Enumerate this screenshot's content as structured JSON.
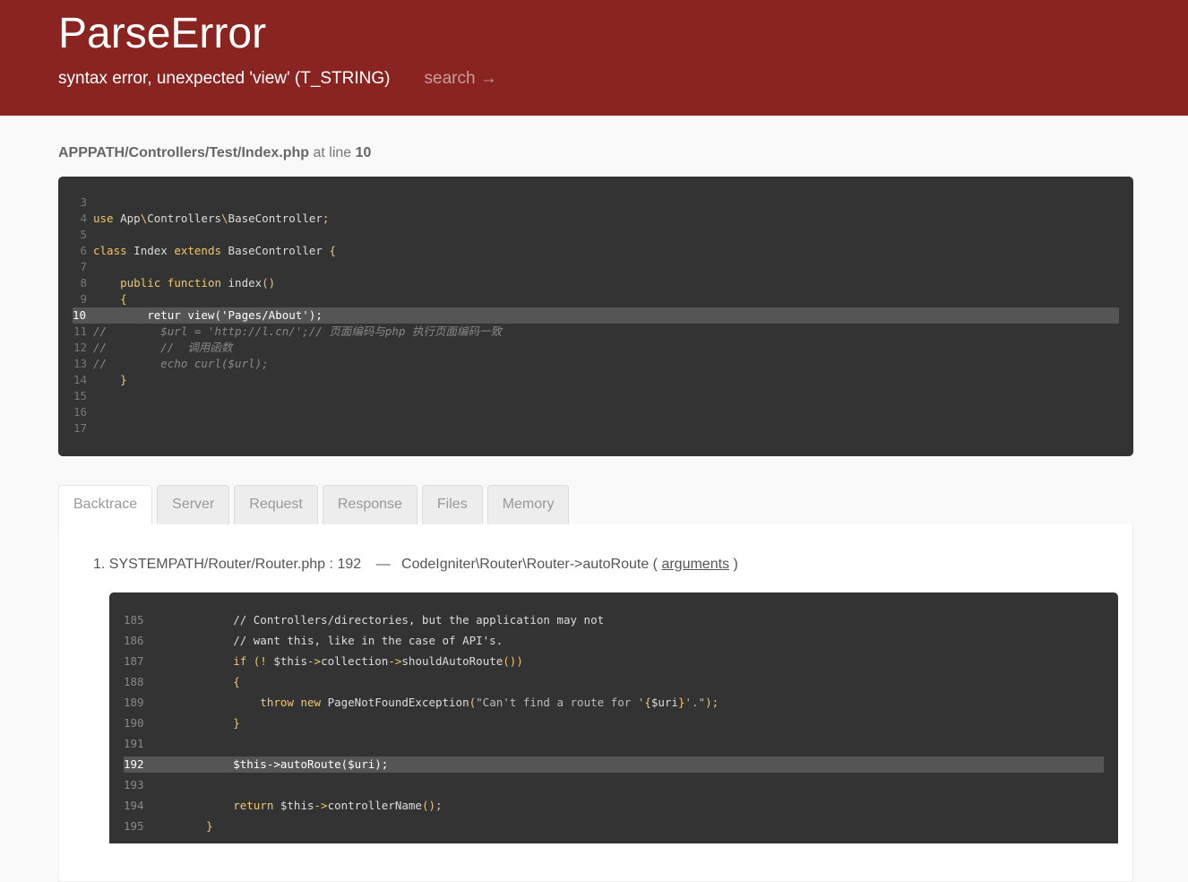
{
  "header": {
    "title": "ParseError",
    "message": "syntax error, unexpected 'view' (T_STRING)",
    "search_label": "search →"
  },
  "file": {
    "path": "APPPATH/Controllers/Test/Index.php",
    "at_line_label": "at line",
    "line": "10"
  },
  "source": {
    "highlight_line": "10",
    "lines": [
      {
        "n": "3",
        "parts": []
      },
      {
        "n": "4",
        "parts": [
          [
            "kw",
            "use"
          ],
          [
            "",
            " App"
          ],
          [
            "kw",
            "\\"
          ],
          [
            "",
            "Controllers"
          ],
          [
            "kw",
            "\\"
          ],
          [
            "",
            "BaseController"
          ],
          [
            "kw",
            ";"
          ]
        ]
      },
      {
        "n": "5",
        "parts": []
      },
      {
        "n": "6",
        "parts": [
          [
            "kw",
            "class"
          ],
          [
            "",
            " Index "
          ],
          [
            "kw",
            "extends"
          ],
          [
            "",
            " BaseController "
          ],
          [
            "kw",
            "{"
          ]
        ]
      },
      {
        "n": "7",
        "parts": []
      },
      {
        "n": "8",
        "parts": [
          [
            "",
            "    "
          ],
          [
            "kw",
            "public function"
          ],
          [
            "",
            " index"
          ],
          [
            "kw",
            "()"
          ]
        ]
      },
      {
        "n": "9",
        "parts": [
          [
            "",
            "    "
          ],
          [
            "kw",
            "{"
          ]
        ]
      },
      {
        "n": "10",
        "parts": [
          [
            "",
            "        retur view('Pages/About');"
          ]
        ]
      },
      {
        "n": "11",
        "parts": [
          [
            "cm",
            "//        $url = 'http://l.cn/';// 页面编码与php 执行页面编码一致"
          ]
        ]
      },
      {
        "n": "12",
        "parts": [
          [
            "cm",
            "//        //  调用函数"
          ]
        ]
      },
      {
        "n": "13",
        "parts": [
          [
            "cm",
            "//        echo curl($url);"
          ]
        ]
      },
      {
        "n": "14",
        "parts": [
          [
            "",
            "    "
          ],
          [
            "kw",
            "}"
          ]
        ]
      },
      {
        "n": "15",
        "parts": []
      },
      {
        "n": "16",
        "parts": []
      },
      {
        "n": "17",
        "parts": []
      }
    ]
  },
  "tabs": [
    "Backtrace",
    "Server",
    "Request",
    "Response",
    "Files",
    "Memory"
  ],
  "backtrace": {
    "index": "1.",
    "file": "SYSTEMPATH/Router/Router.php",
    "line": "192",
    "separator": "—",
    "function": "CodeIgniter\\Router\\Router->autoRoute",
    "open_paren": "(",
    "args_label": "arguments",
    "close_paren": ")",
    "highlight_line": "192",
    "lines": [
      {
        "n": "185",
        "parts": [
          [
            "",
            "        // Controllers/directories, but the application may not"
          ]
        ]
      },
      {
        "n": "186",
        "parts": [
          [
            "",
            "        // want this, like in the case of API's."
          ]
        ]
      },
      {
        "n": "187",
        "parts": [
          [
            "kw",
            "        if (!"
          ],
          [
            "",
            " $this"
          ],
          [
            "kw",
            "->"
          ],
          [
            "",
            "collection"
          ],
          [
            "kw",
            "->"
          ],
          [
            "",
            "shouldAutoRoute"
          ],
          [
            "kw",
            "())"
          ]
        ]
      },
      {
        "n": "188",
        "parts": [
          [
            "kw",
            "        {"
          ]
        ]
      },
      {
        "n": "189",
        "parts": [
          [
            "kw",
            "            throw new"
          ],
          [
            "",
            " PageNotFoundException"
          ],
          [
            "kw",
            "("
          ],
          [
            "str2",
            "\"Can't find a route for '"
          ],
          [
            "kw",
            "{"
          ],
          [
            "",
            "$uri"
          ],
          [
            "kw",
            "}"
          ],
          [
            "str2",
            "'.\""
          ],
          [
            "kw",
            ");"
          ]
        ]
      },
      {
        "n": "190",
        "parts": [
          [
            "kw",
            "        }"
          ]
        ]
      },
      {
        "n": "191",
        "parts": []
      },
      {
        "n": "192",
        "parts": [
          [
            "",
            "        $this->autoRoute($uri);"
          ]
        ]
      },
      {
        "n": "193",
        "parts": []
      },
      {
        "n": "194",
        "parts": [
          [
            "kw",
            "        return"
          ],
          [
            "",
            " $this"
          ],
          [
            "kw",
            "->"
          ],
          [
            "",
            "controllerName"
          ],
          [
            "kw",
            "();"
          ]
        ]
      },
      {
        "n": "195",
        "parts": [
          [
            "kw",
            "    }"
          ]
        ]
      }
    ]
  }
}
